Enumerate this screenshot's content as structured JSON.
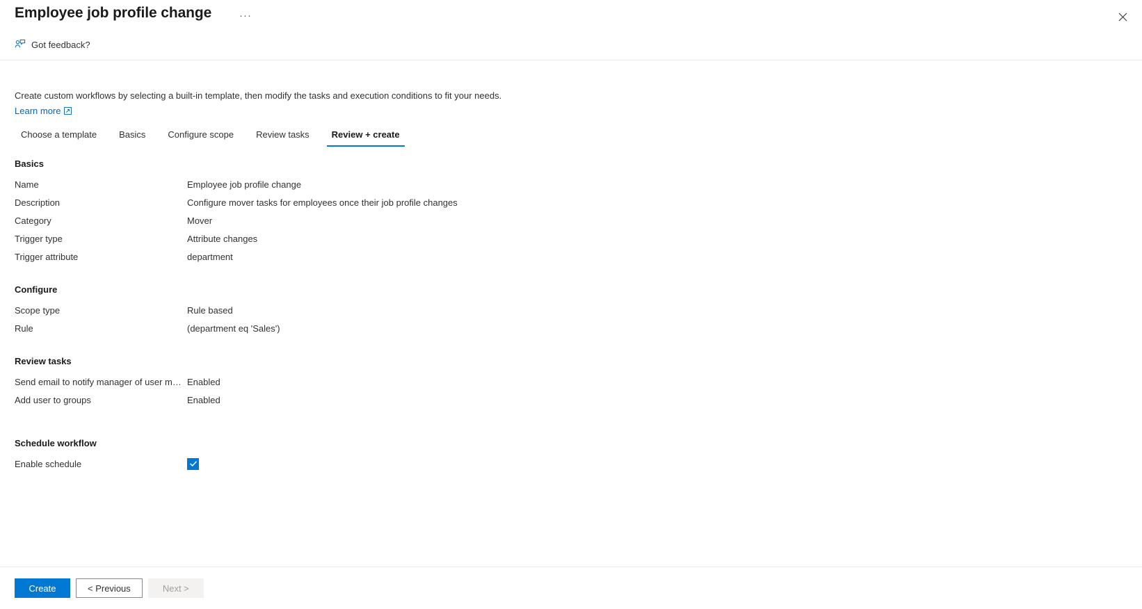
{
  "header": {
    "title": "Employee job profile change",
    "ellipsis_label": "···",
    "close_label": "Close"
  },
  "feedback": {
    "label": "Got feedback?",
    "icon": "feedback-person-icon"
  },
  "intro": {
    "text": "Create custom workflows by selecting a built-in template, then modify the tasks and execution conditions to fit your needs.",
    "learn_more": "Learn more",
    "external_icon": "external-link-icon"
  },
  "tabs": [
    {
      "label": "Choose a template",
      "selected": false
    },
    {
      "label": "Basics",
      "selected": false
    },
    {
      "label": "Configure scope",
      "selected": false
    },
    {
      "label": "Review tasks",
      "selected": false
    },
    {
      "label": "Review + create",
      "selected": true
    }
  ],
  "sections": {
    "basics": {
      "title": "Basics",
      "rows": [
        {
          "key": "Name",
          "value": "Employee job profile change"
        },
        {
          "key": "Description",
          "value": "Configure mover tasks for employees once their job profile changes"
        },
        {
          "key": "Category",
          "value": "Mover"
        },
        {
          "key": "Trigger type",
          "value": "Attribute changes"
        },
        {
          "key": "Trigger attribute",
          "value": "department"
        }
      ]
    },
    "configure": {
      "title": "Configure",
      "rows": [
        {
          "key": "Scope type",
          "value": "Rule based"
        },
        {
          "key": "Rule",
          "value": "(department eq 'Sales')"
        }
      ]
    },
    "review_tasks": {
      "title": "Review tasks",
      "rows": [
        {
          "key": "Send email to notify manager of user mo…",
          "value": "Enabled"
        },
        {
          "key": "Add user to groups",
          "value": "Enabled"
        }
      ]
    },
    "schedule": {
      "title": "Schedule workflow",
      "checkbox_label": "Enable schedule",
      "checked": true
    }
  },
  "footer": {
    "create_label": "Create",
    "previous_label": "< Previous",
    "next_label": "Next >"
  },
  "colors": {
    "accent": "#0078d4",
    "link": "#0067b8",
    "text": "#323130",
    "disabled_text": "#a19f9d",
    "divider": "#edebe9"
  }
}
